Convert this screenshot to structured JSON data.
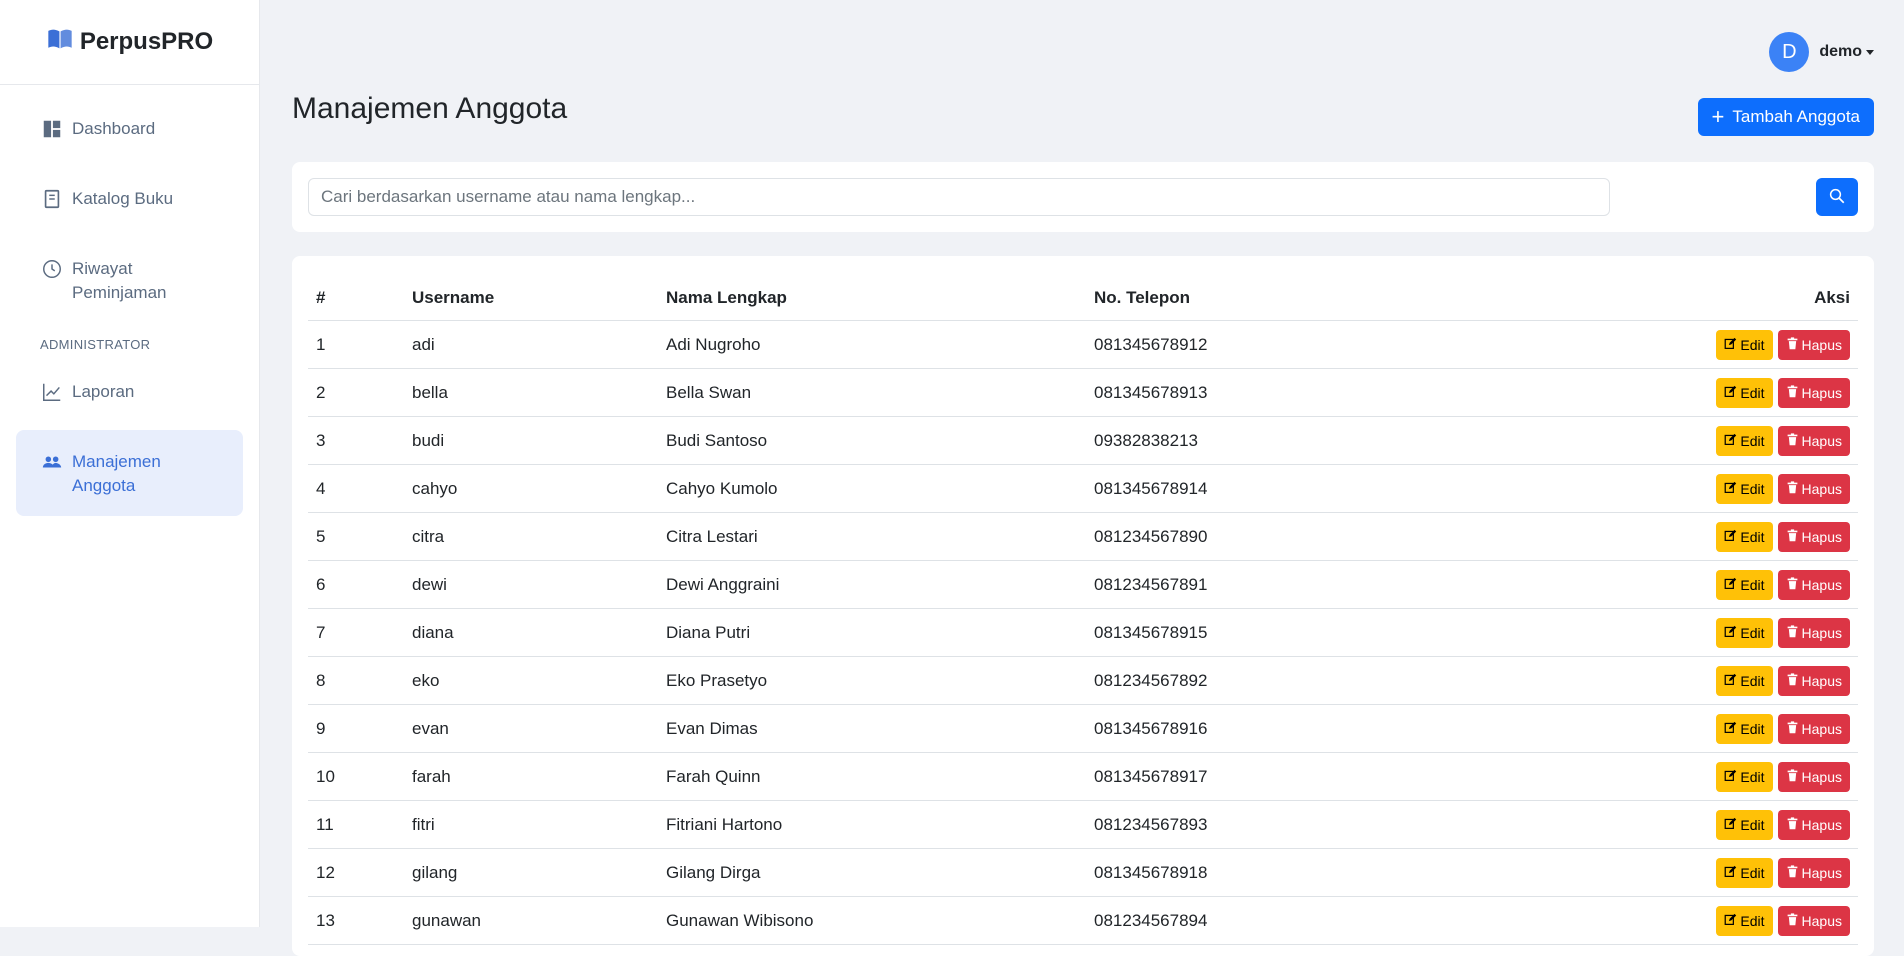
{
  "brand": {
    "name": "PerpusPRO",
    "icon": "book-open-icon",
    "accent": "#3b6fd6"
  },
  "sidebar": {
    "items": [
      {
        "label": "Dashboard",
        "icon": "dashboard-icon"
      },
      {
        "label": "Katalog Buku",
        "icon": "book-icon"
      },
      {
        "label": "Riwayat Peminjaman",
        "icon": "clock-icon"
      }
    ],
    "section_label": "ADMINISTRATOR",
    "admin_items": [
      {
        "label": "Laporan",
        "icon": "chart-line-icon"
      },
      {
        "label": "Manajemen Anggota",
        "icon": "users-icon",
        "active": true
      }
    ]
  },
  "user": {
    "initial": "D",
    "name": "demo"
  },
  "page": {
    "title": "Manajemen Anggota",
    "add_button": "Tambah Anggota"
  },
  "search": {
    "placeholder": "Cari berdasarkan username atau nama lengkap...",
    "value": ""
  },
  "table": {
    "headers": {
      "no": "#",
      "username": "Username",
      "fullname": "Nama Lengkap",
      "phone": "No. Telepon",
      "actions": "Aksi"
    },
    "edit_label": "Edit",
    "delete_label": "Hapus",
    "rows": [
      {
        "no": "1",
        "username": "adi",
        "fullname": "Adi Nugroho",
        "phone": "081345678912"
      },
      {
        "no": "2",
        "username": "bella",
        "fullname": "Bella Swan",
        "phone": "081345678913"
      },
      {
        "no": "3",
        "username": "budi",
        "fullname": "Budi Santoso",
        "phone": "09382838213"
      },
      {
        "no": "4",
        "username": "cahyo",
        "fullname": "Cahyo Kumolo",
        "phone": "081345678914"
      },
      {
        "no": "5",
        "username": "citra",
        "fullname": "Citra Lestari",
        "phone": "081234567890"
      },
      {
        "no": "6",
        "username": "dewi",
        "fullname": "Dewi Anggraini",
        "phone": "081234567891"
      },
      {
        "no": "7",
        "username": "diana",
        "fullname": "Diana Putri",
        "phone": "081345678915"
      },
      {
        "no": "8",
        "username": "eko",
        "fullname": "Eko Prasetyo",
        "phone": "081234567892"
      },
      {
        "no": "9",
        "username": "evan",
        "fullname": "Evan Dimas",
        "phone": "081345678916"
      },
      {
        "no": "10",
        "username": "farah",
        "fullname": "Farah Quinn",
        "phone": "081345678917"
      },
      {
        "no": "11",
        "username": "fitri",
        "fullname": "Fitriani Hartono",
        "phone": "081234567893"
      },
      {
        "no": "12",
        "username": "gilang",
        "fullname": "Gilang Dirga",
        "phone": "081345678918"
      },
      {
        "no": "13",
        "username": "gunawan",
        "fullname": "Gunawan Wibisono",
        "phone": "081234567894"
      }
    ]
  }
}
